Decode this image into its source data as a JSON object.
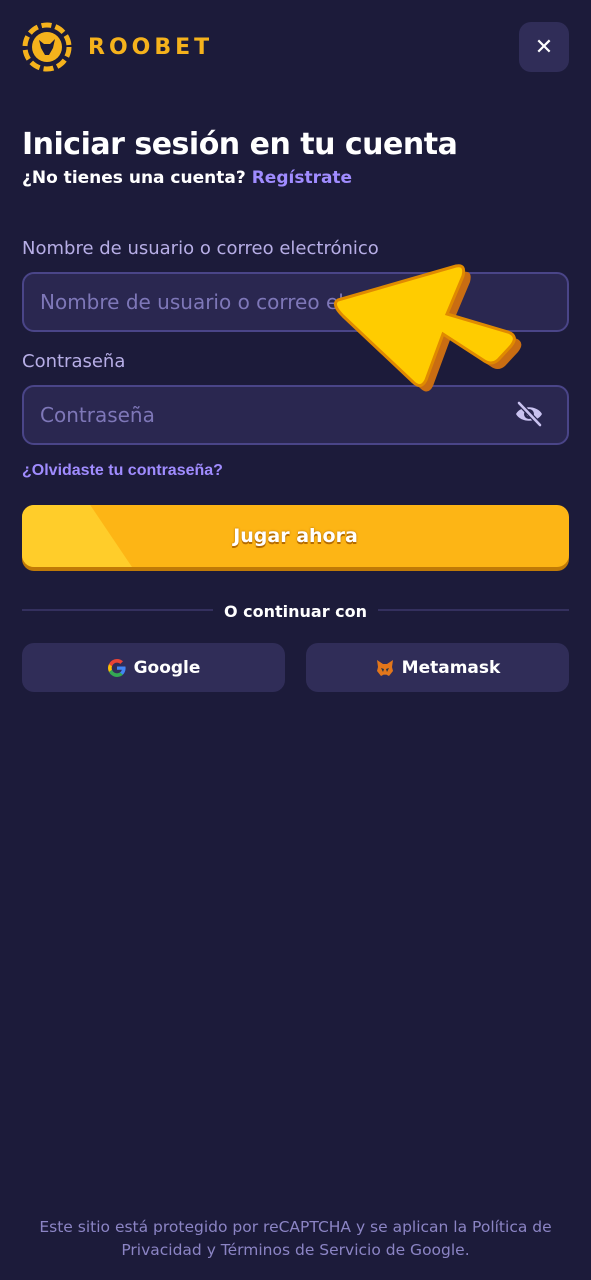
{
  "app": {
    "brand": "ROOBET",
    "close_symbol": "✕",
    "colors": {
      "background": "#1c1b3a",
      "accent": "#a08cff",
      "brand": "#f5b21c",
      "button": "#fdb515"
    }
  },
  "login": {
    "title": "Iniciar sesión en tu cuenta",
    "subtitle_prompt": "¿No tienes una cuenta?",
    "register_link": "Regístrate",
    "username": {
      "label": "Nombre de usuario o correo electrónico",
      "placeholder": "Nombre de usuario o correo electrónico",
      "value": ""
    },
    "password": {
      "label": "Contraseña",
      "placeholder": "Contraseña",
      "value": "",
      "toggle_icon": "eye-off-icon"
    },
    "forgot_link": "¿Olvidaste tu contraseña?",
    "submit_label": "Jugar ahora",
    "divider": "O continuar con",
    "social": [
      {
        "label": "Google",
        "icon": "google-icon"
      },
      {
        "label": "Metamask",
        "icon": "metamask-fox-icon"
      }
    ]
  },
  "footer": {
    "text": "Este sitio está protegido por reCAPTCHA y se aplican la Política de Privacidad y Términos de Servicio de Google."
  },
  "overlay": {
    "icon": "pointer-arrow-icon"
  }
}
